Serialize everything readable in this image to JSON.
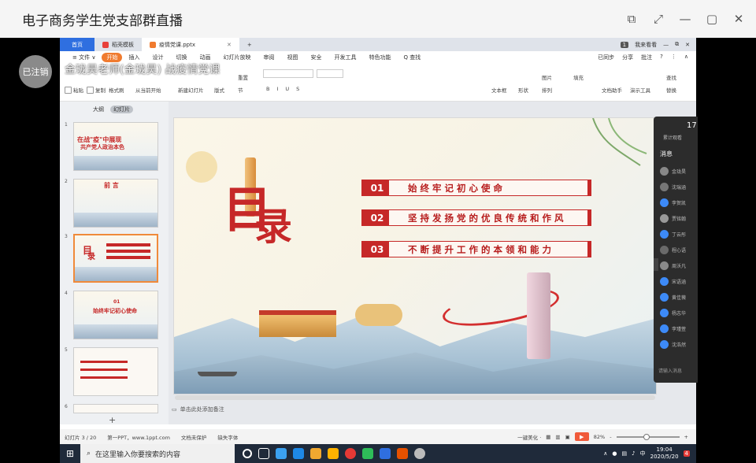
{
  "window": {
    "title": "电子商务学生党支部群直播",
    "controls": [
      "⧉",
      "⤢",
      "—",
      "▢",
      "✕"
    ]
  },
  "stream": {
    "avatar_label": "已注销",
    "watermark": "金珑昊老师(金珑昊) 战疫情党课"
  },
  "wps": {
    "tabs": [
      {
        "label": "首页",
        "kind": "home"
      },
      {
        "label": "稻壳模板",
        "kind": "normal"
      },
      {
        "label": "疫情党课.pptx",
        "kind": "active"
      }
    ],
    "tab_add": "+",
    "top_right": {
      "badge": "1",
      "user": "我来看看",
      "controls": [
        "—",
        "⧉",
        "✕"
      ]
    },
    "menu": [
      "≡ 文件 ∨",
      "开始",
      "插入",
      "设计",
      "切换",
      "动画",
      "幻灯片放映",
      "审阅",
      "视图",
      "安全",
      "开发工具",
      "特色功能",
      "Q 查找"
    ],
    "menu_right": [
      "已同步",
      "分享",
      "批注",
      "?",
      "⋮",
      "∧"
    ],
    "ribbon": {
      "paste": "粘贴",
      "copy": "复制",
      "format_painter": "格式刷",
      "from_current": "从当前开始",
      "new_slide": "新建幻灯片",
      "layout": "版式",
      "section": "节",
      "reset": "重置",
      "font_bold_italic": [
        "B",
        "I",
        "U",
        "S"
      ],
      "text_box": "文本框",
      "shape": "形状",
      "arrange": "排列",
      "picture": "图片",
      "fill": "填充",
      "text_assistant": "文档助手",
      "present_tools": "演示工具",
      "find": "查找",
      "replace": "替换"
    },
    "panel_tabs": {
      "outline": "大纲",
      "slides": "幻灯片"
    },
    "thumbnails": [
      {
        "num": "1",
        "title": "在战\"疫\"中展现",
        "subtitle": "共产党人政治本色"
      },
      {
        "num": "2",
        "title": "前 言",
        "subtitle": ""
      },
      {
        "num": "3",
        "title": "目",
        "subtitle": "录"
      },
      {
        "num": "4",
        "title": "01",
        "subtitle": "始终牢记初心使命"
      },
      {
        "num": "5",
        "title": "",
        "subtitle": ""
      },
      {
        "num": "6",
        "title": "",
        "subtitle": ""
      }
    ],
    "add_slide": "+",
    "slide": {
      "heading_big": "目",
      "heading_small": "录",
      "items": [
        {
          "num": "01",
          "text": "始终牢记初心使命"
        },
        {
          "num": "02",
          "text": "坚持发扬党的优良传统和作风"
        },
        {
          "num": "03",
          "text": "不断提升工作的本领和能力"
        }
      ]
    },
    "notes_placeholder": "单击此处添加备注",
    "status": {
      "slide_counter": "幻灯片 3 / 20",
      "theme": "第一PPT，www.1ppt.com",
      "protect": "文档未保护",
      "missing_font": "缺失字体",
      "beautify": "一键美化 ·",
      "zoom": "82%",
      "zoom_minus": "-",
      "zoom_plus": "+"
    }
  },
  "chat": {
    "count": "17",
    "count_label": "累计观看",
    "messages_label": "消息",
    "members": [
      "金珑昊",
      "沈瑞涵",
      "李贺凯",
      "贾铭翰",
      "丁云彤",
      "程心语",
      "周沃凡",
      "宋语涵",
      "黄佳薇",
      "杨志华",
      "李瑾萱",
      "沈浩然"
    ],
    "input_placeholder": "请输入消息"
  },
  "taskbar": {
    "search_placeholder": "在这里输入你要搜索的内容",
    "ime": "中",
    "time": "19:04",
    "date": "2020/5/20",
    "notify_badge": "4"
  },
  "colors": {
    "accent_red": "#c62828",
    "wps_blue": "#2f6fe0",
    "start_orange": "#f07b2f"
  }
}
